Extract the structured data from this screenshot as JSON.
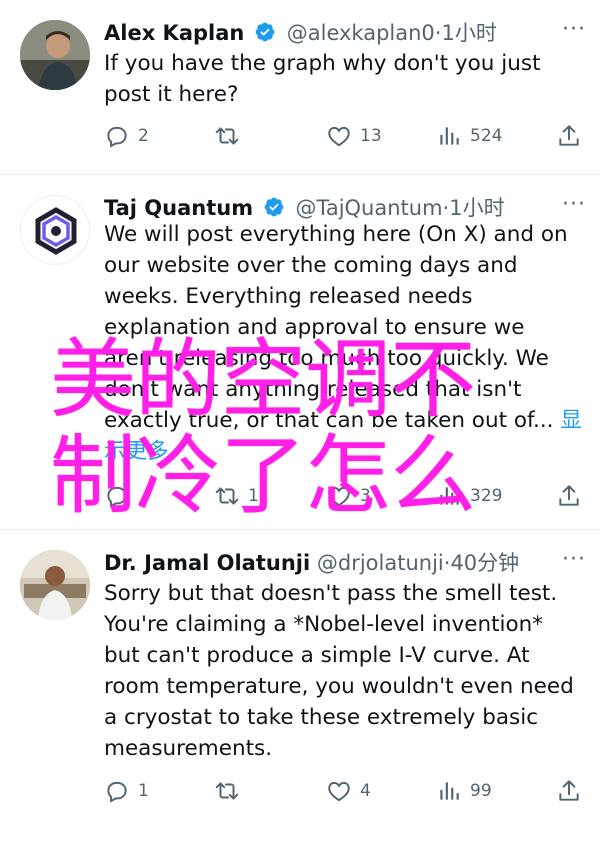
{
  "tweets": [
    {
      "name": "Alex Kaplan",
      "handle": "@alexkaplan0",
      "dot": "·",
      "time": "1小时",
      "text": "If you have the graph why don't you just post it here?",
      "show_more": "",
      "replies": "2",
      "retweets": "",
      "likes": "13",
      "views": "524"
    },
    {
      "name": "Taj Quantum",
      "handle": "@TajQuantum",
      "dot": "·",
      "time": "1小时",
      "text": "We will post everything here (On X) and on our website over the coming days and weeks. Everything released needs explanation and approval to ensure we aren't releasing too much too quickly. We don't want anything released that isn't exactly true, or that can be taken out of...",
      "show_more": "显示更多",
      "replies": "",
      "retweets": "1",
      "likes": "3",
      "views": "329"
    },
    {
      "name": "Dr. Jamal Olatunji",
      "handle": "@drjolatunji",
      "dot": "·",
      "time": "40分钟",
      "text": "Sorry but that doesn't pass the smell test. You're claiming a *Nobel-level invention* but can't produce a simple I-V curve. At room temperature, you wouldn't even need a cryostat to take these extremely basic measurements.",
      "show_more": "",
      "replies": "1",
      "retweets": "",
      "likes": "4",
      "views": "99"
    }
  ],
  "overlay_text": "美的空调不\n制冷了怎么",
  "more_label": "···",
  "colors": {
    "accent": "#1d9bf0",
    "muted": "#536471",
    "overlay": "#ff1fe6"
  }
}
